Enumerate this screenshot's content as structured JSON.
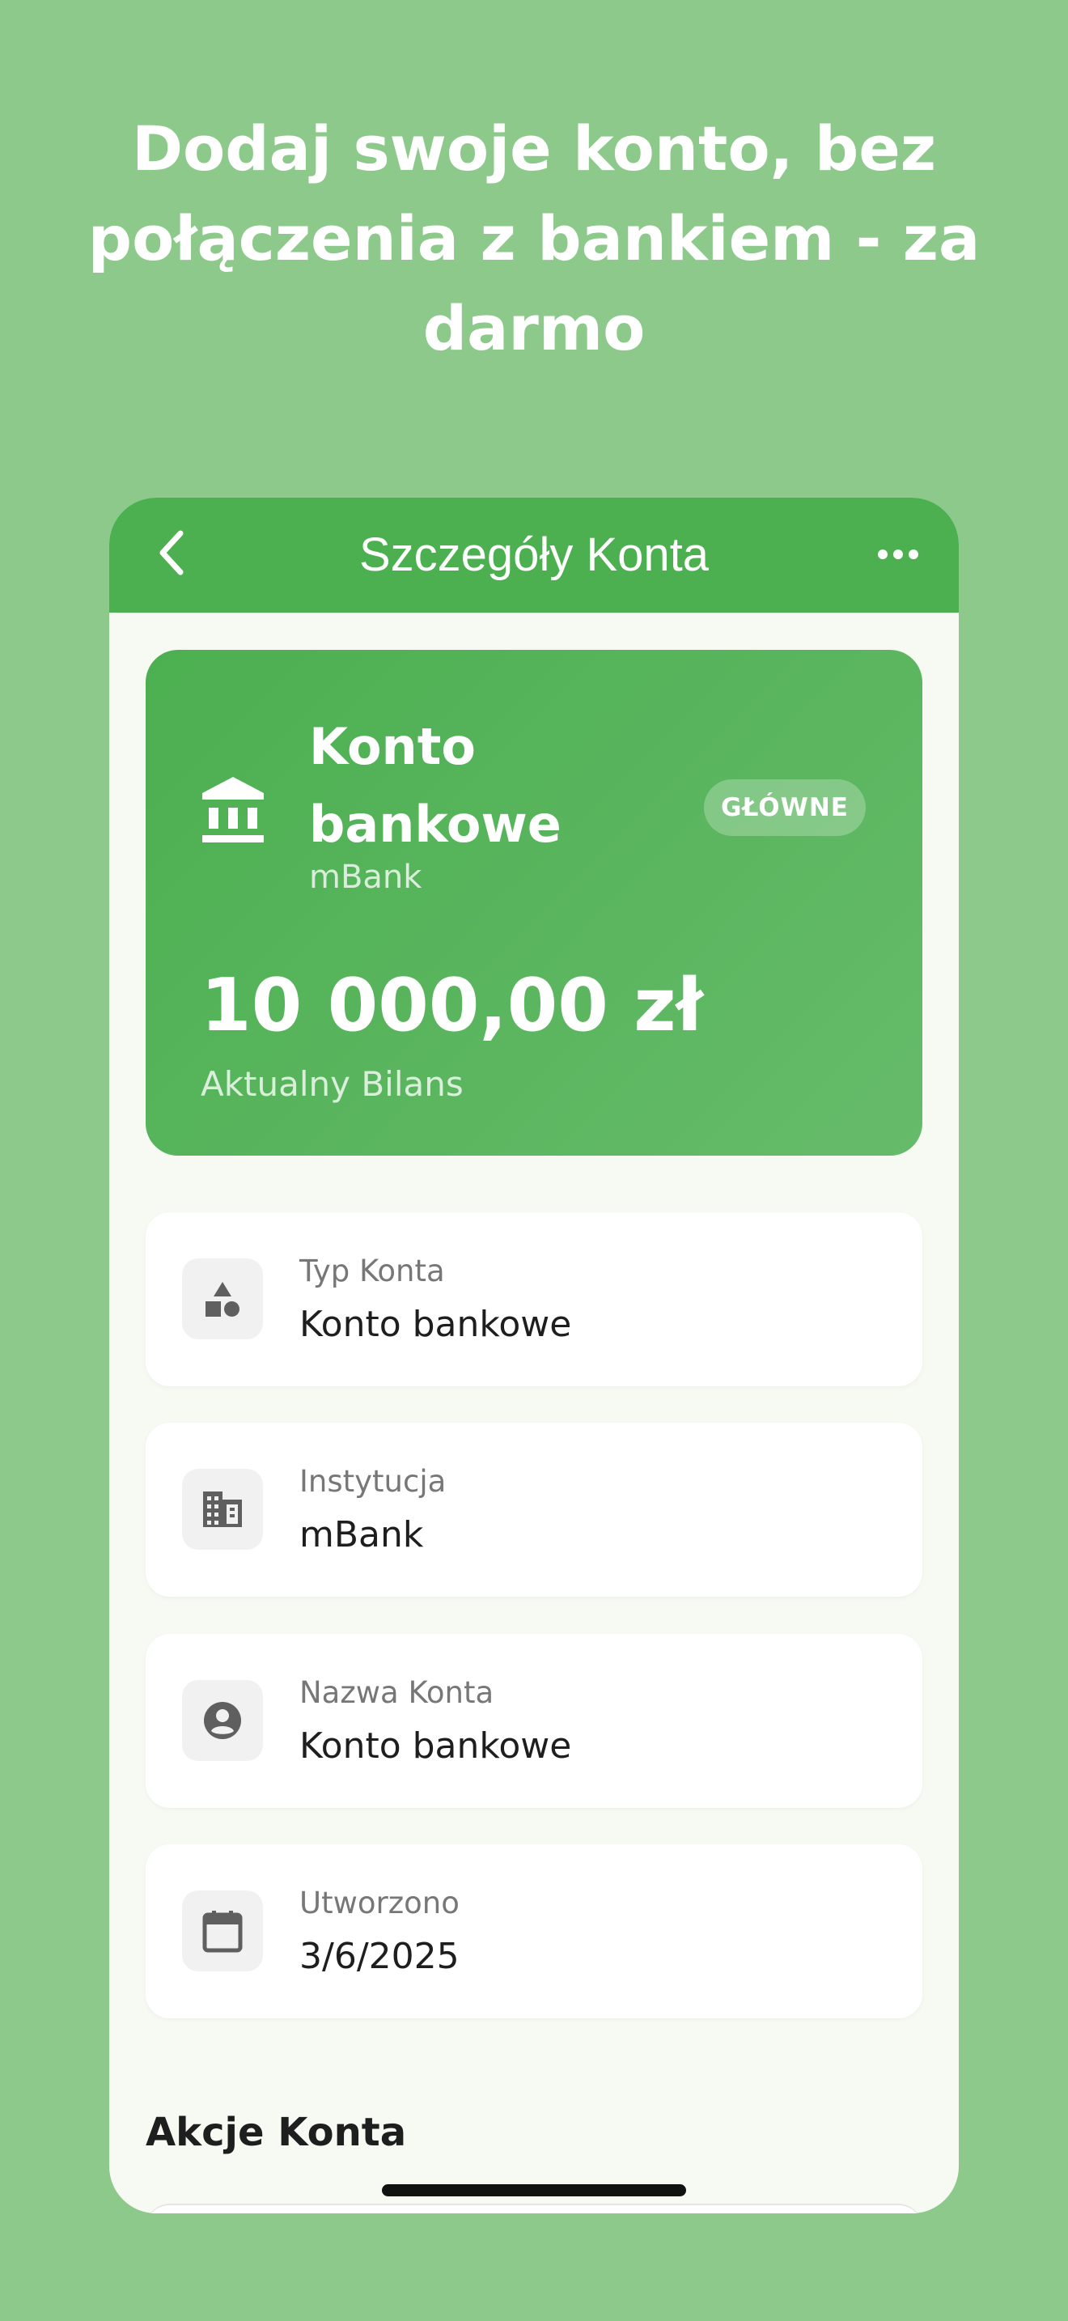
{
  "headline": "Dodaj swoje konto, bez połączenia z bankiem - za darmo",
  "navbar": {
    "title": "Szczegóły Konta",
    "back_icon": "chevron-left-icon",
    "more_icon": "more-horizontal-icon"
  },
  "balance_card": {
    "icon": "bank-icon",
    "title": "Konto bankowe",
    "subtitle": "mBank",
    "badge": "GŁÓWNE",
    "amount": "10 000,00 zł",
    "amount_label": "Aktualny Bilans"
  },
  "details": [
    {
      "icon": "category-shapes-icon",
      "label": "Typ Konta",
      "value": "Konto bankowe"
    },
    {
      "icon": "building-icon",
      "label": "Instytucja",
      "value": "mBank"
    },
    {
      "icon": "account-circle-icon",
      "label": "Nazwa Konta",
      "value": "Konto bankowe"
    },
    {
      "icon": "calendar-icon",
      "label": "Utworzono",
      "value": "3/6/2025"
    }
  ],
  "actions_section": {
    "title": "Akcje Konta"
  },
  "colors": {
    "background": "#8cc98b",
    "primary": "#4caf50",
    "primary_light": "#66bb6a",
    "screen": "#f7f9f3",
    "text": "#1e1e1e",
    "muted": "#777777",
    "icon": "#5f5f5f"
  }
}
